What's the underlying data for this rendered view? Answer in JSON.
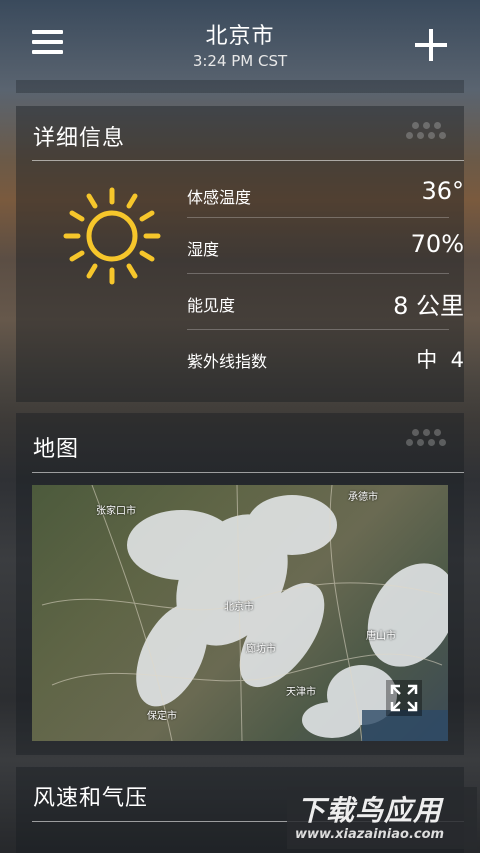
{
  "header": {
    "city": "北京市",
    "time": "3:24 PM CST"
  },
  "details": {
    "title": "详细信息",
    "rows": [
      {
        "label": "体感温度",
        "value": "36°"
      },
      {
        "label": "湿度",
        "value": "70%"
      },
      {
        "label": "能见度",
        "value": "8 公里"
      },
      {
        "label": "紫外线指数",
        "value": "中  4"
      }
    ]
  },
  "map": {
    "title": "地图",
    "labels": [
      "张家口市",
      "承德市",
      "北京市",
      "廊坊市",
      "唐山市",
      "天津市",
      "保定市"
    ]
  },
  "wind": {
    "title": "风速和气压"
  },
  "watermark": {
    "big": "下载鸟应用",
    "small": "www.xiazainiao.com"
  },
  "colors": {
    "sun": "#f6c62b"
  }
}
